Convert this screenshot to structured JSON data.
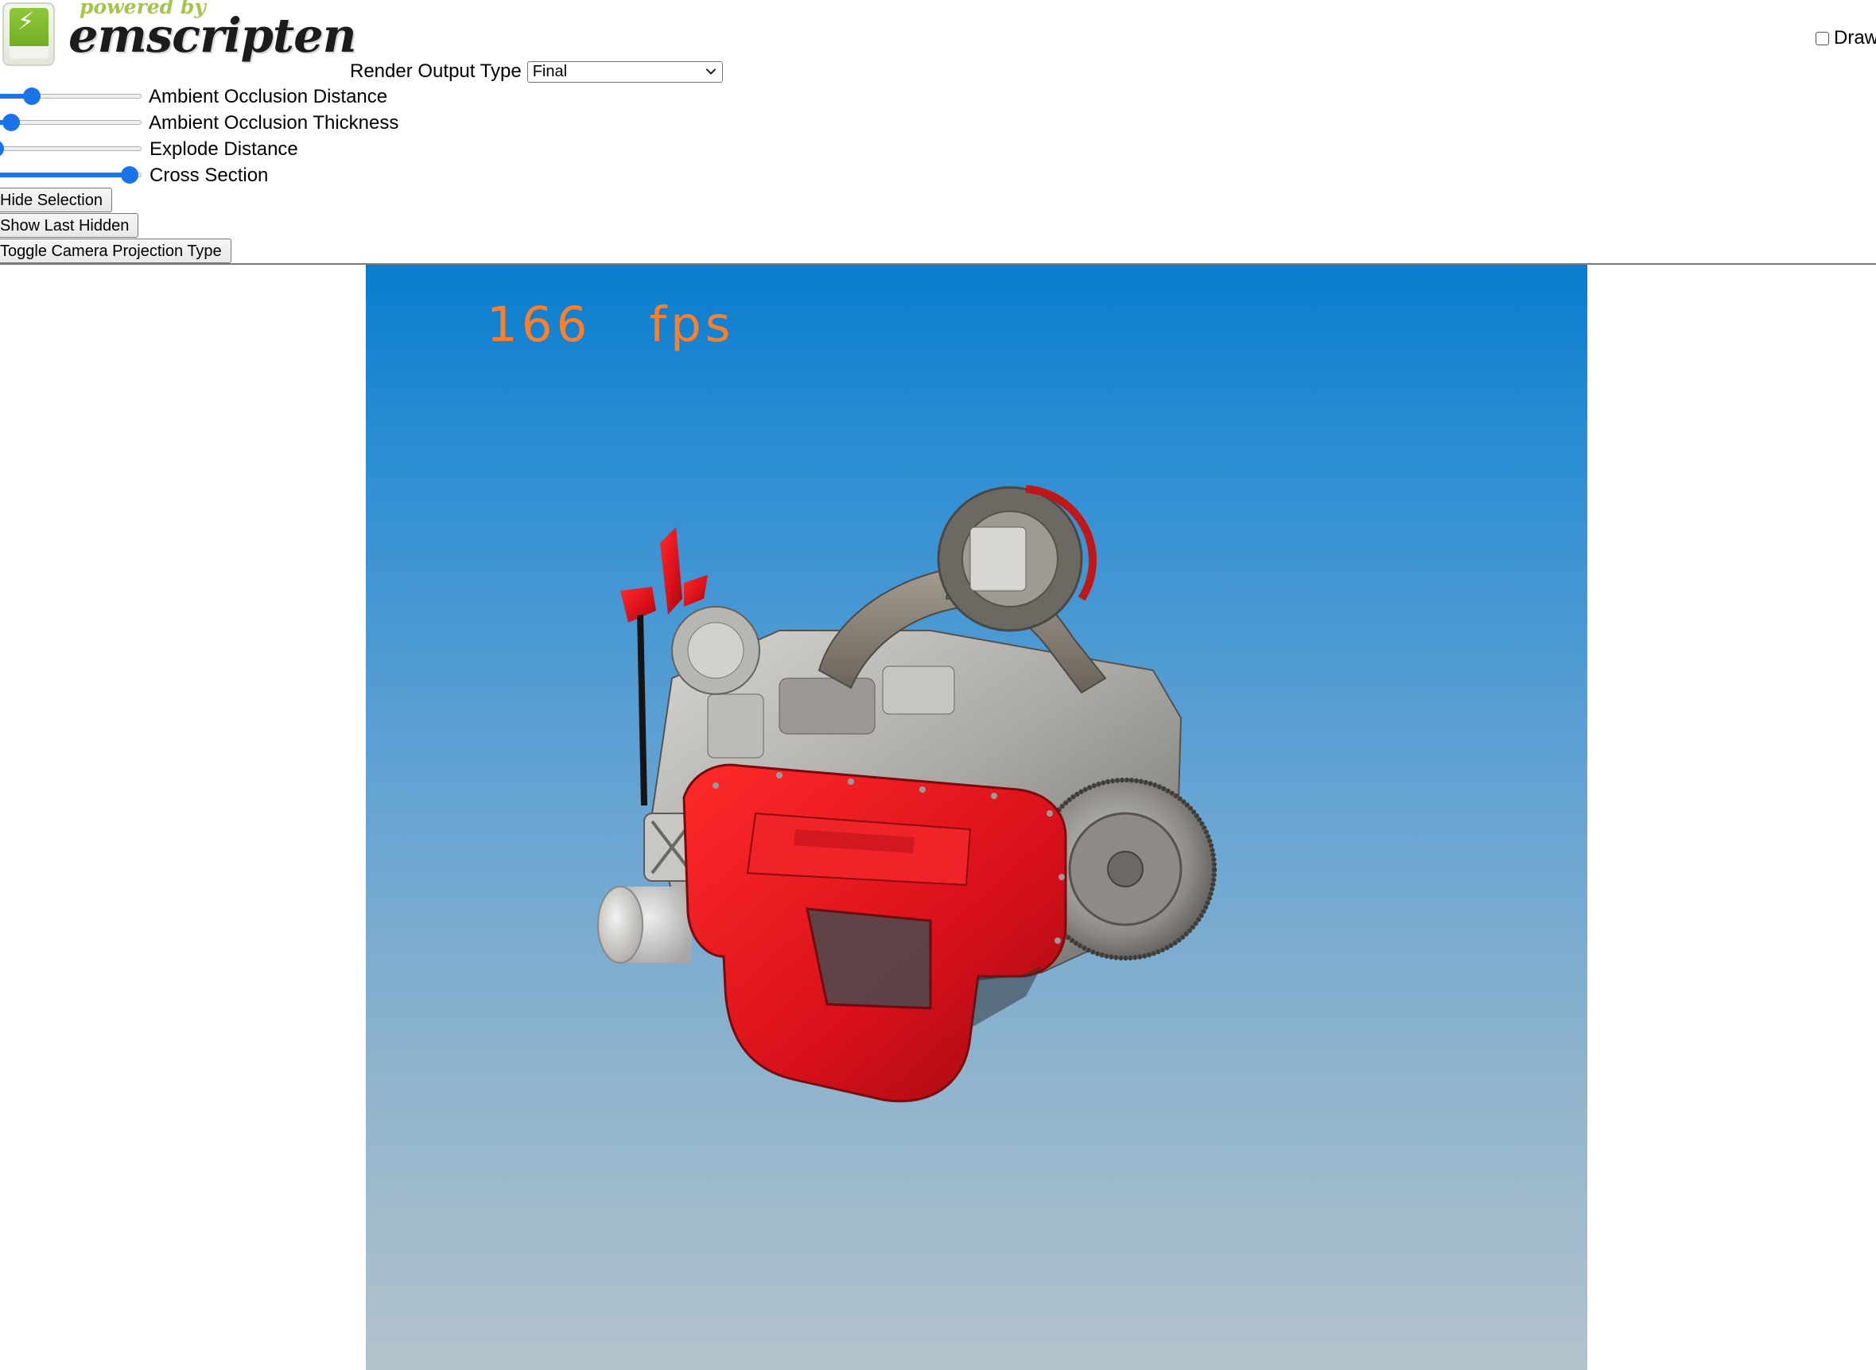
{
  "logo": {
    "powered_by": "powered by",
    "name": "emscripten"
  },
  "controls": {
    "render_output_type_label": "Render Output Type",
    "render_output_type_value": "Final",
    "sliders": [
      {
        "label": "Ambient Occlusion Distance",
        "value": 0.25
      },
      {
        "label": "Ambient Occlusion Thickness",
        "value": 0.11
      },
      {
        "label": "Explode Distance",
        "value": 0.0
      },
      {
        "label": "Cross Section",
        "value": 0.92
      }
    ],
    "buttons": {
      "hide_selection": "Hide Selection",
      "show_last_hidden": "Show Last Hidden",
      "toggle_camera_projection": "Toggle Camera Projection Type"
    },
    "draw_checkbox_label": "Draw",
    "draw_checked": false
  },
  "viewport": {
    "fps_value": "166",
    "fps_unit": "fps",
    "fps_color": "#ff7e2a",
    "background_top": "#087dcf",
    "background_bottom": "#b3c3cc",
    "model_accent": "#e0161b"
  }
}
